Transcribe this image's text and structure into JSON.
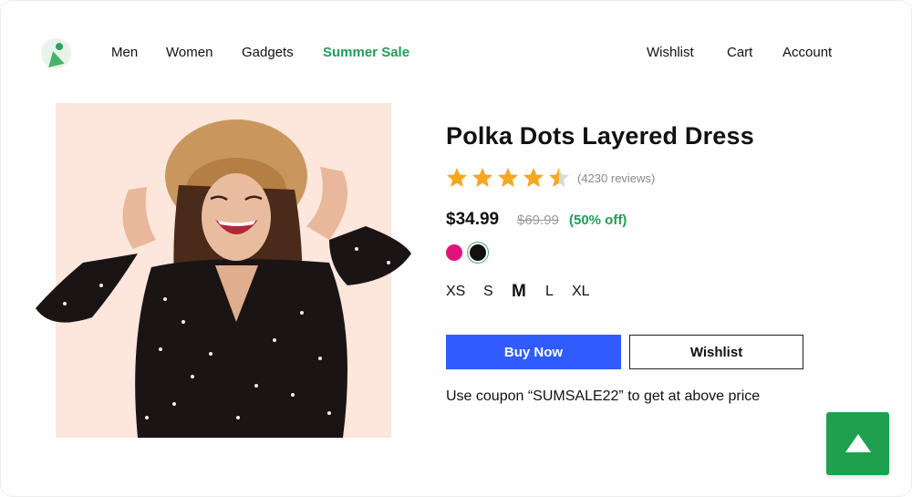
{
  "nav": {
    "left": [
      "Men",
      "Women",
      "Gadgets"
    ],
    "sale": "Summer Sale",
    "right": [
      "Wishlist",
      "Cart",
      "Account"
    ]
  },
  "product": {
    "title": "Polka Dots Layered Dress",
    "rating": 4.5,
    "rating_max": 5,
    "reviews": "(4230 reviews)",
    "price": "$34.99",
    "old_price": "$69.99",
    "discount": "(50% off)",
    "colors": [
      {
        "name": "pink",
        "hex": "#e1137a"
      },
      {
        "name": "black",
        "hex": "#111111",
        "selected": true
      }
    ],
    "sizes": [
      "XS",
      "S",
      "M",
      "L",
      "XL"
    ],
    "selected_size": "M",
    "buy_label": "Buy Now",
    "wishlist_label": "Wishlist",
    "coupon_text": "Use coupon “SUMSALE22” to get at above price"
  },
  "colors": {
    "accent_green": "#1f9d55",
    "buy_blue": "#2f5bff",
    "star": "#f5a623",
    "image_bg": "#fde6db"
  },
  "icons": {
    "logo": "logo-icon",
    "scroll_top": "arrow-up-icon"
  }
}
